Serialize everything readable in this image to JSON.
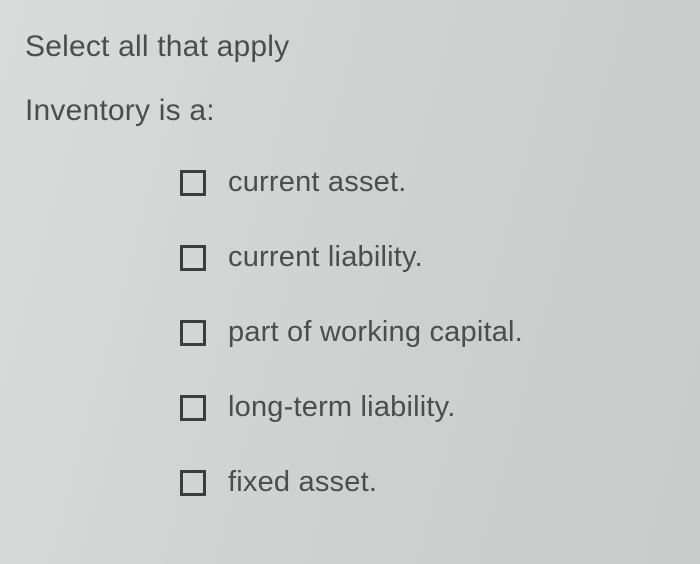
{
  "instruction": "Select all that apply",
  "question": "Inventory is a:",
  "options": [
    {
      "label": "current asset."
    },
    {
      "label": "current liability."
    },
    {
      "label": "part of working capital."
    },
    {
      "label": "long-term liability."
    },
    {
      "label": "fixed asset."
    }
  ]
}
